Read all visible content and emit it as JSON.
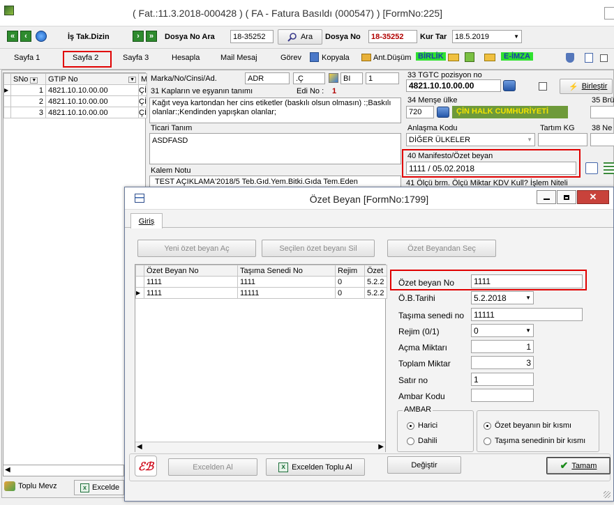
{
  "window": {
    "title": "( Fat.:11.3.2018-000428 ) ( FA  - Fatura Basıldı (000547) ) [FormNo:225]"
  },
  "toolbar": {
    "is_tak_dizin": "İş Tak.Dizin",
    "dosya_no_ara_label": "Dosya No Ara",
    "dosya_no_ara_value": "18-35252",
    "ara_button": "Ara",
    "dosya_no_label": "Dosya No",
    "dosya_no_value": "18-35252",
    "kur_tar_label": "Kur Tar",
    "kur_tar_value": "18.5.2019"
  },
  "tabs": {
    "sayfa1": "Sayfa 1",
    "sayfa2": "Sayfa 2",
    "sayfa3": "Sayfa 3",
    "hesapla": "Hesapla",
    "mail_mesaj": "Mail Mesaj",
    "gorev": "Görev",
    "kopyala": "Kopyala",
    "ant_dusum": "Ant.Düşüm",
    "birlik": "BİRLİK",
    "e_imza": "E-İMZA"
  },
  "main_grid": {
    "headers": [
      "SNo",
      "GTIP No",
      "Me"
    ],
    "rows": [
      {
        "sno": "1",
        "gtip": "4821.10.10.00.00",
        "me": "ÇİI"
      },
      {
        "sno": "2",
        "gtip": "4821.10.10.00.00",
        "me": "ÇİI"
      },
      {
        "sno": "3",
        "gtip": "4821.10.10.00.00",
        "me": "ÇİI"
      }
    ]
  },
  "form": {
    "marka_label": "Marka/No/Cinsi/Ad.",
    "marka_value": "ADR",
    "marka_c": ".Ç",
    "marka_bi": "BI",
    "marka_num": "1",
    "kaplar_label": "31 Kapların ve eşyanın tanımı",
    "edi_no_label": "Edi No :",
    "edi_no_value": "1",
    "description": "Kağıt veya kartondan her cins etiketler (baskılı olsun olmasın) :;Baskılı olanlar:;Kendinden yapışkan olanlar;",
    "ticari_tanim_label": "Ticari Tanım",
    "ticari_tanim_value": "ASDFASD",
    "kalem_notu_label": "Kalem Notu",
    "kalem_notu_value": "TEST AÇIKLAMA'2018/5 Teb.Gıd.Yem.Bitki.Gıda Tem.Eden",
    "gtip_label": "33 TGTC pozisyon no",
    "gtip_value": "4821.10.10.00.00",
    "birlestir": "Birleştir",
    "mense_label": "34 Menşe ülke",
    "mense_code": "720",
    "mense_name": "ÇİN HALK CUMHURİYETİ",
    "brut_label": "35 Brü",
    "anlasma_label": "Anlaşma Kodu",
    "anlasma_value": "DİĞER ÜLKELER",
    "tartim_label": "Tartım KG",
    "net_label": "38 Ne",
    "manifesto_label": "40 Manifesto/Özet beyan",
    "manifesto_value": "1111 / 05.02.2018",
    "bottom_row_label": "41 Ölçü brm.  Ölçü Miktar        KDV    Kull?   İşlem Niteli"
  },
  "bottom_bar": {
    "toplu_mevz": "Toplu Mevz",
    "excelde": "Excelde"
  },
  "dialog": {
    "title": "Özet Beyan [FormNo:1799]",
    "tab": "Giriş",
    "btn_yeni": "Yeni özet beyan Aç",
    "btn_sil": "Seçilen özet beyanı Sil",
    "btn_sec": "Özet Beyandan Seç",
    "grid_headers": [
      "Özet Beyan No",
      "Taşıma Senedi No",
      "Rejim",
      "Özet"
    ],
    "grid_rows": [
      {
        "ozet_no": "1111",
        "tasima": "1111",
        "rejim": "0",
        "ozet": "5.2.2"
      },
      {
        "ozet_no": "1111",
        "tasima": "11111",
        "rejim": "0",
        "ozet": "5.2.2"
      }
    ],
    "fields": {
      "ozet_no_label": "Özet beyan No",
      "ozet_no_value": "1111",
      "tarih_label": "Ö.B.Tarihi",
      "tarih_value": "5.2.2018",
      "tasima_label": "Taşıma senedi no",
      "tasima_value": "11111",
      "rejim_label": "Rejim  (0/1)",
      "rejim_value": "0",
      "acma_label": "Açma Miktarı",
      "acma_value": "1",
      "toplam_label": "Toplam Miktar",
      "toplam_value": "3",
      "satir_label": "Satır no",
      "satir_value": "1",
      "ambar_kodu_label": "Ambar Kodu",
      "ambar_kodu_value": ""
    },
    "ambar_group": "AMBAR",
    "radio_harici": "Harici",
    "radio_dahili": "Dahili",
    "radio_ozet": "Özet beyanın bir kısmı",
    "radio_tasima": "Taşıma senedinin bir kısmı",
    "btn_excelden": "Excelden Al",
    "btn_excelden_toplu": "Excelden Toplu Al",
    "btn_degistir": "Değiştir",
    "btn_tamam": "Tamam"
  }
}
